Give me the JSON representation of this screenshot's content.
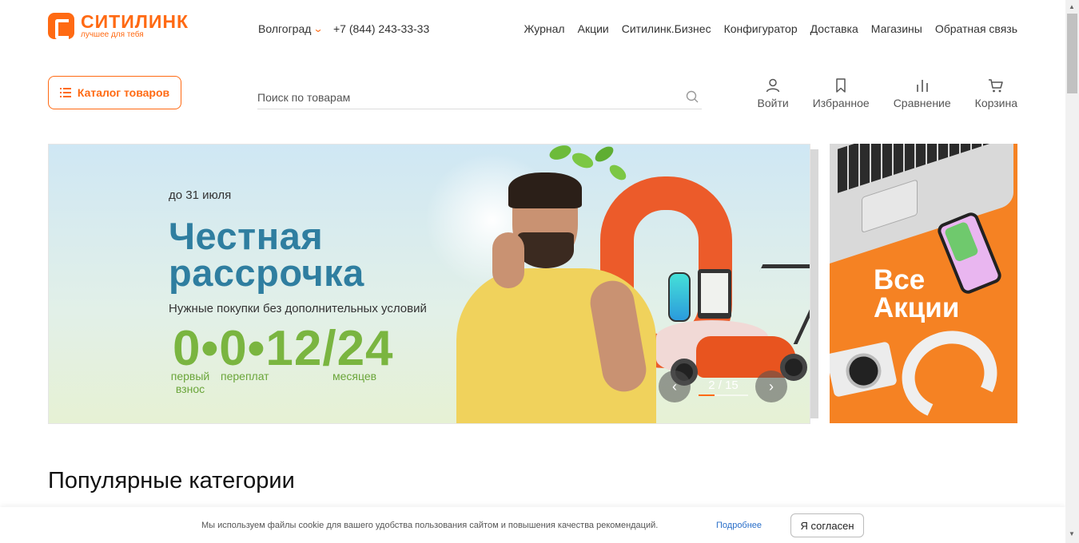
{
  "brand": {
    "name": "СИТИЛИНК",
    "tagline": "лучшее для тебя",
    "color": "#ff6a13"
  },
  "top": {
    "city": "Волгоград",
    "phone": "+7 (844) 243-33-33",
    "nav": [
      "Журнал",
      "Акции",
      "Ситилинк.Бизнес",
      "Конфигуратор",
      "Доставка",
      "Магазины",
      "Обратная связь"
    ]
  },
  "header": {
    "catalog_label": "Каталог товаров",
    "search_placeholder": "Поиск по товарам",
    "actions": [
      {
        "label": "Войти",
        "icon": "user-icon"
      },
      {
        "label": "Избранное",
        "icon": "bookmark-icon"
      },
      {
        "label": "Сравнение",
        "icon": "compare-icon"
      },
      {
        "label": "Корзина",
        "icon": "cart-icon"
      }
    ]
  },
  "banner": {
    "date": "до 31 июля",
    "title_line1": "Честная",
    "title_line2": "рассрочка",
    "subtitle": "Нужные покупки без дополнительных условий",
    "big": "0•0•12/24",
    "cap1": "первый взнос",
    "cap2": "переплат",
    "cap3": "месяцев",
    "pager": "2 / 15",
    "prev": "‹",
    "next": "›"
  },
  "side_banner": {
    "line1": "Все",
    "line2": "Акции"
  },
  "popular": {
    "title": "Популярные категории"
  },
  "cookie": {
    "text": "Мы используем файлы cookie для вашего удобства пользования сайтом и повышения качества рекомендаций.",
    "link": "Подробнее",
    "button": "Я согласен"
  }
}
